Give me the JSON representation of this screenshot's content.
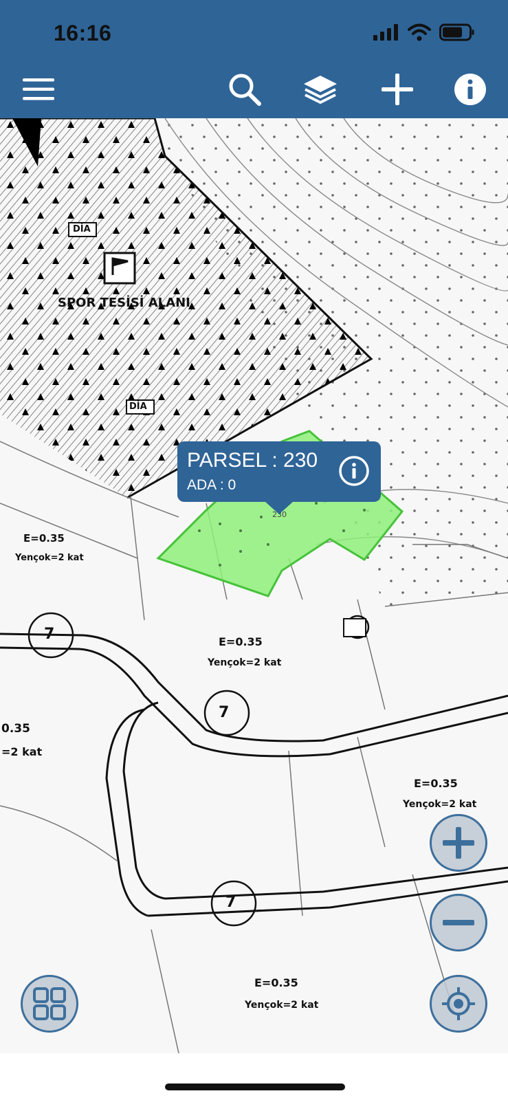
{
  "status_bar": {
    "time": "16:16"
  },
  "toolbar": {
    "icons": [
      "menu-icon",
      "search-icon",
      "layers-icon",
      "add-icon",
      "info-icon"
    ]
  },
  "map": {
    "labels": {
      "spor": "SPOR TESİSİ ALANI",
      "dia1": "DİA",
      "dia2": "DİA",
      "e035_a": "E=0.35",
      "kat_a": "Yençok=2 kat",
      "e035_b": "E=0.35",
      "kat_b": "Yençok=2 kat",
      "e035_c": "E=0.35",
      "kat_c": "Yençok=2 kat",
      "e035_d": "E=0.35",
      "kat_d": "Yençok=2 kat",
      "left_035": "0.35",
      "left_kat": "=2 kat",
      "num_230": "230",
      "road_7a": "7",
      "road_7b": "7",
      "road_7c": "7"
    },
    "highlight_color": "#8ef07a"
  },
  "popup": {
    "title": "PARSEL : 230",
    "subtitle": "ADA : 0"
  },
  "controls": {
    "zoom_in": "zoom-in-icon",
    "zoom_out": "zoom-out-icon",
    "locate": "locate-icon",
    "grid": "grid-icon"
  },
  "colors": {
    "brand": "#2f6497",
    "accent_button": "#3d6f9c"
  }
}
